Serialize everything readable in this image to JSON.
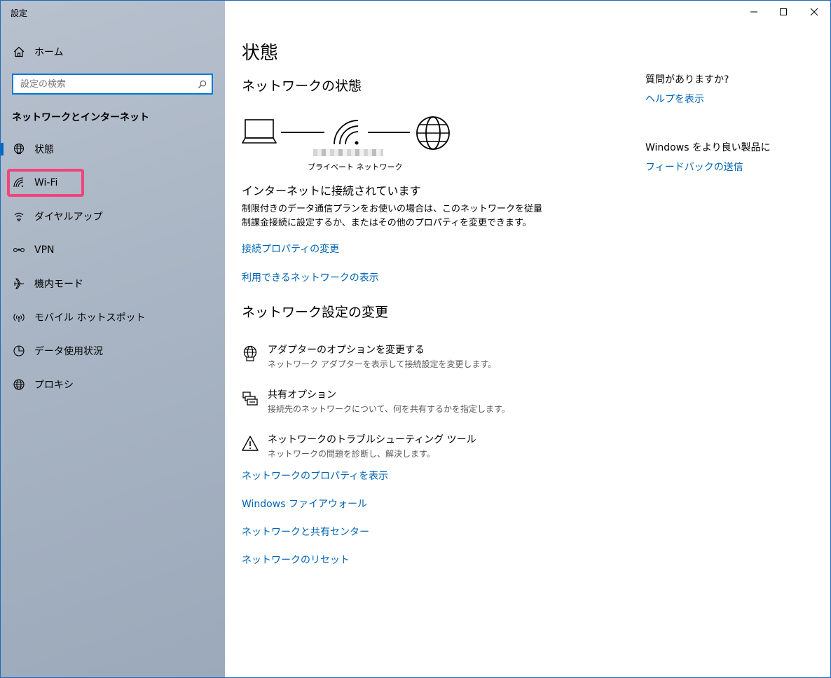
{
  "window": {
    "title": "設定",
    "controls": [
      "minimize-icon",
      "maximize-icon",
      "close-icon"
    ]
  },
  "sidebar": {
    "home_label": "ホーム",
    "search_placeholder": "設定の検索",
    "section_title": "ネットワークとインターネット",
    "items": [
      {
        "label": "状態",
        "icon": "globe-status-icon",
        "active": true
      },
      {
        "label": "Wi-Fi",
        "icon": "wifi-icon",
        "active": false
      },
      {
        "label": "ダイヤルアップ",
        "icon": "dialup-icon",
        "active": false
      },
      {
        "label": "VPN",
        "icon": "vpn-icon",
        "active": false
      },
      {
        "label": "機内モード",
        "icon": "airplane-icon",
        "active": false
      },
      {
        "label": "モバイル ホットスポット",
        "icon": "hotspot-icon",
        "active": false
      },
      {
        "label": "データ使用状況",
        "icon": "data-usage-icon",
        "active": false
      },
      {
        "label": "プロキシ",
        "icon": "globe-icon",
        "active": false
      }
    ],
    "accent_color": "#0067c0",
    "highlight_color": "#f0457a"
  },
  "main": {
    "title": "状態",
    "network_status_heading": "ネットワークの状態",
    "network_type": "プライベート ネットワーク",
    "connected_title": "インターネットに接続されています",
    "connected_desc_line1": "制限付きのデータ通信プランをお使いの場合は、このネットワークを従量",
    "connected_desc_line2": "制課金接続に設定するか、またはその他のプロパティを変更できます。",
    "link_change_properties": "接続プロパティの変更",
    "link_show_networks": "利用できるネットワークの表示",
    "change_settings_heading": "ネットワーク設定の変更",
    "options": [
      {
        "title": "アダプターのオプションを変更する",
        "desc": "ネットワーク アダプターを表示して接続設定を変更します。",
        "icon": "adapter-icon"
      },
      {
        "title": "共有オプション",
        "desc": "接続先のネットワークについて、何を共有するかを指定します。",
        "icon": "sharing-icon"
      },
      {
        "title": "ネットワークのトラブルシューティング ツール",
        "desc": "ネットワークの問題を診断し、解決します。",
        "icon": "warning-icon"
      }
    ],
    "links": [
      "ネットワークのプロパティを表示",
      "Windows ファイアウォール",
      "ネットワークと共有センター",
      "ネットワークのリセット"
    ],
    "link_color": "#0063b1"
  },
  "aside": {
    "question": "質問がありますか?",
    "help_link": "ヘルプを表示",
    "feedback_prompt": "Windows をより良い製品に",
    "feedback_link": "フィードバックの送信"
  }
}
